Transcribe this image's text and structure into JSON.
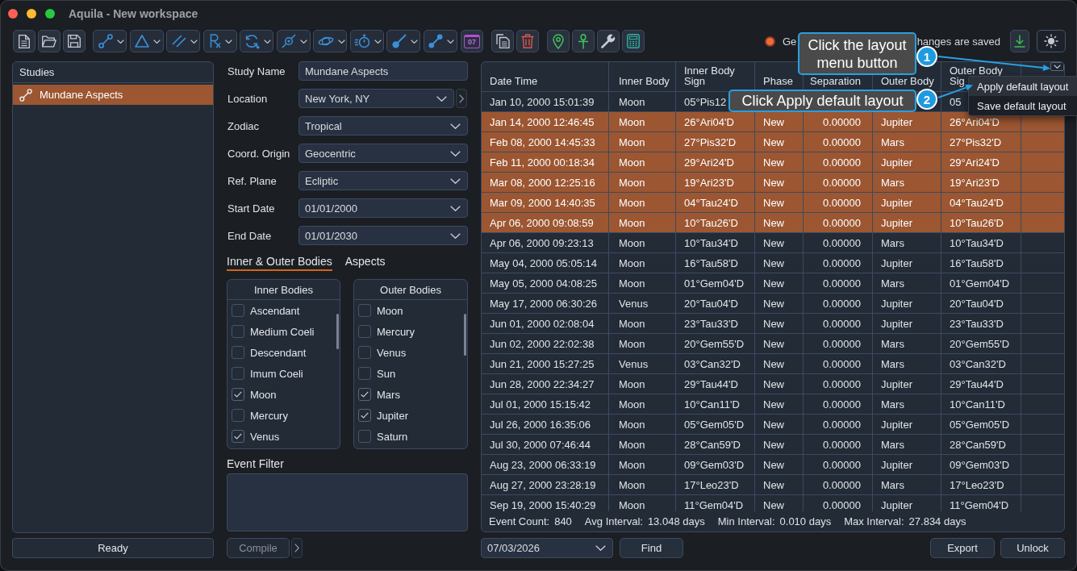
{
  "window": {
    "title": "Aquila - New workspace"
  },
  "toolbar": {
    "calendar_day": "07",
    "status_text_parts": [
      "Ge",
      "hanges are saved"
    ]
  },
  "studies": {
    "title": "Studies",
    "items": [
      {
        "label": "Mundane Aspects",
        "selected": true
      }
    ]
  },
  "status_bar": {
    "text": "Ready"
  },
  "study_form": {
    "fields": [
      {
        "label": "Study Name",
        "kind": "text",
        "value": "Mundane Aspects"
      },
      {
        "label": "Location",
        "kind": "dropdown_next",
        "value": "New York, NY"
      },
      {
        "label": "Zodiac",
        "kind": "dropdown",
        "value": "Tropical"
      },
      {
        "label": "Coord. Origin",
        "kind": "dropdown",
        "value": "Geocentric"
      },
      {
        "label": "Ref. Plane",
        "kind": "dropdown",
        "value": "Ecliptic"
      },
      {
        "label": "Start Date",
        "kind": "dropdown",
        "value": "01/01/2000"
      },
      {
        "label": "End Date",
        "kind": "dropdown",
        "value": "01/01/2030"
      }
    ]
  },
  "body_tabs": [
    {
      "label": "Inner & Outer Bodies",
      "selected": true
    },
    {
      "label": "Aspects",
      "selected": false
    }
  ],
  "inner_bodies": {
    "title": "Inner Bodies",
    "items": [
      {
        "label": "Ascendant",
        "checked": false
      },
      {
        "label": "Medium Coeli",
        "checked": false
      },
      {
        "label": "Descendant",
        "checked": false
      },
      {
        "label": "Imum Coeli",
        "checked": false
      },
      {
        "label": "Moon",
        "checked": true
      },
      {
        "label": "Mercury",
        "checked": false
      },
      {
        "label": "Venus",
        "checked": true
      }
    ]
  },
  "outer_bodies": {
    "title": "Outer Bodies",
    "items": [
      {
        "label": "Moon",
        "checked": false
      },
      {
        "label": "Mercury",
        "checked": false
      },
      {
        "label": "Venus",
        "checked": false
      },
      {
        "label": "Sun",
        "checked": false
      },
      {
        "label": "Mars",
        "checked": true
      },
      {
        "label": "Jupiter",
        "checked": true
      },
      {
        "label": "Saturn",
        "checked": false
      }
    ]
  },
  "event_filter": {
    "label": "Event Filter"
  },
  "compile_button": {
    "label": "Compile",
    "disabled": true
  },
  "table": {
    "columns": [
      {
        "label": "Date Time"
      },
      {
        "label": "Inner Body"
      },
      {
        "label": "Inner Body Sign"
      },
      {
        "label": "Phase"
      },
      {
        "label": "Separation"
      },
      {
        "label": "Outer Body"
      },
      {
        "label": "Outer Body Sig"
      }
    ],
    "rows": [
      {
        "date_time": "Jan 10, 2000 15:01:39",
        "inner_body": "Moon",
        "inner_body_sign": "05°Pis12",
        "outer_body_sign": "05",
        "selected": false
      },
      {
        "date_time": "Jan 14, 2000 12:46:45",
        "inner_body": "Moon",
        "inner_body_sign": "26°Ari04'D",
        "phase": "New",
        "separation": "0.00000",
        "outer_body": "Jupiter",
        "outer_body_sign": "26°Ari04'D",
        "selected": true
      },
      {
        "date_time": "Feb 08, 2000 14:45:33",
        "inner_body": "Moon",
        "inner_body_sign": "27°Pis32'D",
        "phase": "New",
        "separation": "0.00000",
        "outer_body": "Mars",
        "outer_body_sign": "27°Pis32'D",
        "selected": true
      },
      {
        "date_time": "Feb 11, 2000 00:18:34",
        "inner_body": "Moon",
        "inner_body_sign": "29°Ari24'D",
        "phase": "New",
        "separation": "0.00000",
        "outer_body": "Jupiter",
        "outer_body_sign": "29°Ari24'D",
        "selected": true
      },
      {
        "date_time": "Mar 08, 2000 12:25:16",
        "inner_body": "Moon",
        "inner_body_sign": "19°Ari23'D",
        "phase": "New",
        "separation": "0.00000",
        "outer_body": "Mars",
        "outer_body_sign": "19°Ari23'D",
        "selected": true
      },
      {
        "date_time": "Mar 09, 2000 14:40:35",
        "inner_body": "Moon",
        "inner_body_sign": "04°Tau24'D",
        "phase": "New",
        "separation": "0.00000",
        "outer_body": "Jupiter",
        "outer_body_sign": "04°Tau24'D",
        "selected": true
      },
      {
        "date_time": "Apr 06, 2000 09:08:59",
        "inner_body": "Moon",
        "inner_body_sign": "10°Tau26'D",
        "phase": "New",
        "separation": "0.00000",
        "outer_body": "Jupiter",
        "outer_body_sign": "10°Tau26'D",
        "selected": true
      },
      {
        "date_time": "Apr 06, 2000 09:23:13",
        "inner_body": "Moon",
        "inner_body_sign": "10°Tau34'D",
        "phase": "New",
        "separation": "0.00000",
        "outer_body": "Mars",
        "outer_body_sign": "10°Tau34'D",
        "selected": false
      },
      {
        "date_time": "May 04, 2000 05:05:14",
        "inner_body": "Moon",
        "inner_body_sign": "16°Tau58'D",
        "phase": "New",
        "separation": "0.00000",
        "outer_body": "Jupiter",
        "outer_body_sign": "16°Tau58'D",
        "selected": false
      },
      {
        "date_time": "May 05, 2000 04:08:25",
        "inner_body": "Moon",
        "inner_body_sign": "01°Gem04'D",
        "phase": "New",
        "separation": "0.00000",
        "outer_body": "Mars",
        "outer_body_sign": "01°Gem04'D",
        "selected": false
      },
      {
        "date_time": "May 17, 2000 06:30:26",
        "inner_body": "Venus",
        "inner_body_sign": "20°Tau04'D",
        "phase": "New",
        "separation": "0.00000",
        "outer_body": "Jupiter",
        "outer_body_sign": "20°Tau04'D",
        "selected": false
      },
      {
        "date_time": "Jun 01, 2000 02:08:04",
        "inner_body": "Moon",
        "inner_body_sign": "23°Tau33'D",
        "phase": "New",
        "separation": "0.00000",
        "outer_body": "Jupiter",
        "outer_body_sign": "23°Tau33'D",
        "selected": false
      },
      {
        "date_time": "Jun 02, 2000 22:02:38",
        "inner_body": "Moon",
        "inner_body_sign": "20°Gem55'D",
        "phase": "New",
        "separation": "0.00000",
        "outer_body": "Mars",
        "outer_body_sign": "20°Gem55'D",
        "selected": false
      },
      {
        "date_time": "Jun 21, 2000 15:27:25",
        "inner_body": "Venus",
        "inner_body_sign": "03°Can32'D",
        "phase": "New",
        "separation": "0.00000",
        "outer_body": "Mars",
        "outer_body_sign": "03°Can32'D",
        "selected": false
      },
      {
        "date_time": "Jun 28, 2000 22:34:27",
        "inner_body": "Moon",
        "inner_body_sign": "29°Tau44'D",
        "phase": "New",
        "separation": "0.00000",
        "outer_body": "Jupiter",
        "outer_body_sign": "29°Tau44'D",
        "selected": false
      },
      {
        "date_time": "Jul 01, 2000 15:15:42",
        "inner_body": "Moon",
        "inner_body_sign": "10°Can11'D",
        "phase": "New",
        "separation": "0.00000",
        "outer_body": "Mars",
        "outer_body_sign": "10°Can11'D",
        "selected": false
      },
      {
        "date_time": "Jul 26, 2000 16:35:06",
        "inner_body": "Moon",
        "inner_body_sign": "05°Gem05'D",
        "phase": "New",
        "separation": "0.00000",
        "outer_body": "Jupiter",
        "outer_body_sign": "05°Gem05'D",
        "selected": false
      },
      {
        "date_time": "Jul 30, 2000 07:46:44",
        "inner_body": "Moon",
        "inner_body_sign": "28°Can59'D",
        "phase": "New",
        "separation": "0.00000",
        "outer_body": "Mars",
        "outer_body_sign": "28°Can59'D",
        "selected": false
      },
      {
        "date_time": "Aug 23, 2000 06:33:19",
        "inner_body": "Moon",
        "inner_body_sign": "09°Gem03'D",
        "phase": "New",
        "separation": "0.00000",
        "outer_body": "Jupiter",
        "outer_body_sign": "09°Gem03'D",
        "selected": false
      },
      {
        "date_time": "Aug 27, 2000 23:28:19",
        "inner_body": "Moon",
        "inner_body_sign": "17°Leo23'D",
        "phase": "New",
        "separation": "0.00000",
        "outer_body": "Mars",
        "outer_body_sign": "17°Leo23'D",
        "selected": false
      },
      {
        "date_time": "Sep 19, 2000 15:40:29",
        "inner_body": "Moon",
        "inner_body_sign": "11°Gem04'D",
        "phase": "New",
        "separation": "0.00000",
        "outer_body": "Jupiter",
        "outer_body_sign": "11°Gem04'D",
        "selected": false
      }
    ]
  },
  "summary": [
    {
      "label": "Event Count:",
      "value": "840"
    },
    {
      "label": "Avg Interval:",
      "value": "13.048 days"
    },
    {
      "label": "Min Interval:",
      "value": "0.010 days"
    },
    {
      "label": "Max Interval:",
      "value": "27.834 days"
    }
  ],
  "find_date": {
    "value": "07/03/2026"
  },
  "find_button": {
    "label": "Find"
  },
  "actions": [
    {
      "label": "Export"
    },
    {
      "label": "Unlock"
    }
  ],
  "layout_menu": {
    "items": [
      {
        "label": "Apply default layout",
        "highlighted": true
      },
      {
        "label": "Save default layout",
        "highlighted": false
      }
    ]
  },
  "callouts": [
    {
      "number": "1",
      "text": "Click the layout menu button"
    },
    {
      "number": "2",
      "text": "Click Apply default layout"
    }
  ]
}
